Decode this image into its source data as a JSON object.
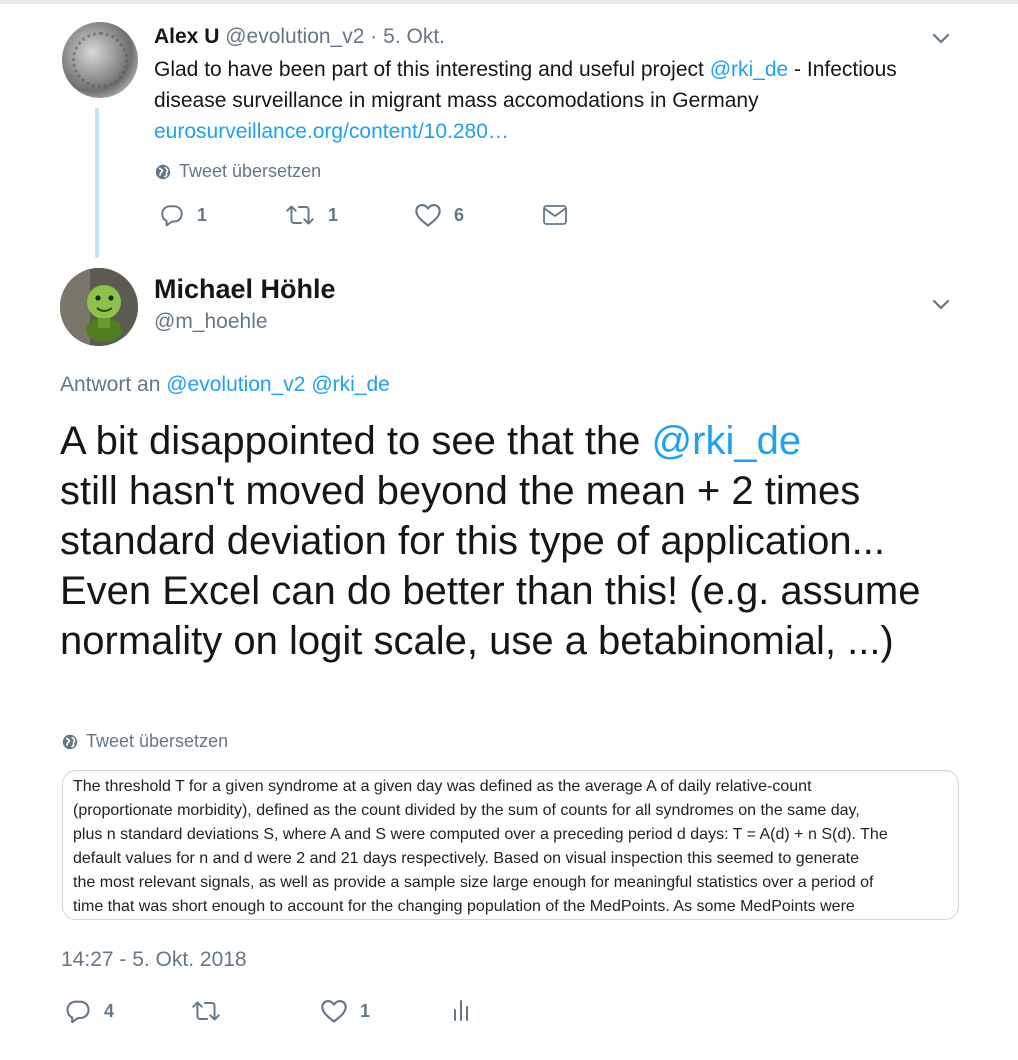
{
  "colors": {
    "link": "#1da1f2",
    "muted": "#657786",
    "text": "#14171a",
    "thread_line": "#c4e3f9"
  },
  "parent_tweet": {
    "author_name": "Alex U",
    "handle": "@evolution_v2",
    "separator": "·",
    "date": "5. Okt.",
    "text_before": "Glad to have been part of this interesting and useful project ",
    "mention": "@rki_de",
    "text_after": " - Infectious disease surveillance in migrant mass accomodations in Germany",
    "link": "eurosurveillance.org/content/10.280…",
    "translate_label": "Tweet übersetzen",
    "actions": {
      "reply_count": "1",
      "retweet_count": "1",
      "like_count": "6"
    },
    "icons": {
      "avatar": "avatar-image",
      "menu": "chevron-down-icon",
      "globe": "globe-icon",
      "reply": "reply-icon",
      "retweet": "retweet-icon",
      "like": "heart-icon",
      "dm": "envelope-icon"
    }
  },
  "main_tweet": {
    "author_name": "Michael Höhle",
    "handle": "@m_hoehle",
    "reply_prefix": "Antwort an",
    "reply_mention_1": "@evolution_v2",
    "reply_mention_2": "@rki_de",
    "text_before": "A bit disappointed to see that the ",
    "mention": "@rki_de",
    "text_after": " still hasn't moved beyond the mean + 2 times standard deviation for this type of application... Even Excel can do better than this! (e.g. assume normality on logit scale, use a betabinomial, ...)",
    "translate_label": "Tweet übersetzen",
    "quoted_image_text": {
      "l1": "The threshold T for a given syndrome at a given day was defined as the average A of daily relative-count",
      "l2": "(proportionate morbidity), defined as the count divided by the sum of counts for all syndromes on the same day,",
      "l3": "plus n standard deviations S, where A and S were computed over a preceding period d days: T = A(d) + n S(d). The",
      "l4": "default values for n and d were 2 and 21 days respectively. Based on visual inspection this seemed to generate",
      "l5": "the most relevant signals, as well as provide a sample size large enough for meaningful statistics over a period of",
      "l6": "time that was short enough to account for the changing population of the MedPoints. As some MedPoints were"
    },
    "timestamp": "14:27 - 5. Okt. 2018",
    "actions": {
      "reply_count": "4",
      "retweet_count": "",
      "like_count": "1"
    },
    "icons": {
      "avatar": "avatar-image",
      "menu": "chevron-down-icon",
      "globe": "globe-icon",
      "reply": "reply-icon",
      "retweet": "retweet-icon",
      "like": "heart-icon",
      "analytics": "bar-chart-icon"
    }
  }
}
